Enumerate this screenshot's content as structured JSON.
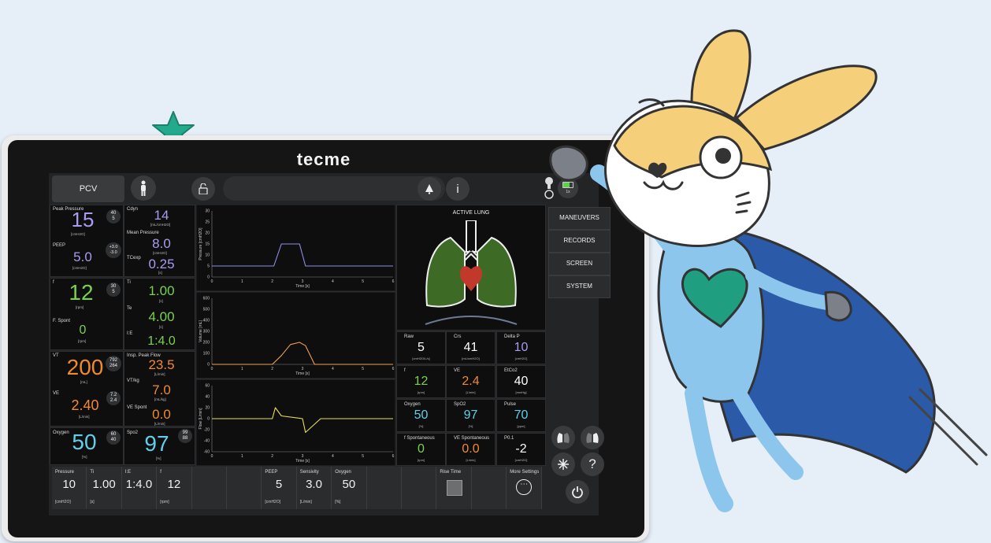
{
  "brand": "tecme",
  "top_bar": {
    "mode": "PCV",
    "info_icon_label": "i",
    "battery_label": "1x"
  },
  "left_panels": {
    "peak_pressure": {
      "label": "Peak Pressure",
      "value": "15",
      "unit": "[cmH2O]",
      "limit_high": "40",
      "limit_low": "5"
    },
    "peep": {
      "label": "PEEP",
      "value": "5.0",
      "unit": "[cmH2O]",
      "limit_high": "+3.0",
      "limit_low": "-3.0"
    },
    "cdyn": {
      "label": "Cdyn",
      "value": "14",
      "unit": "[mL/cmH2O]"
    },
    "mean_pressure": {
      "label": "Mean Pressure",
      "value": "8.0",
      "unit": "[cmH2O]"
    },
    "tcexp": {
      "label": "TCexp",
      "value": "0.25",
      "unit": "[s]"
    },
    "f": {
      "label": "f",
      "value": "12",
      "unit": "[rpm]",
      "limit_high": "30",
      "limit_low": "5"
    },
    "f_spont": {
      "label": "F. Spont",
      "value": "0",
      "unit": "[rpm]"
    },
    "ti": {
      "label": "Ti",
      "value": "1.00",
      "unit": "[s]"
    },
    "te": {
      "label": "Te",
      "value": "4.00",
      "unit": "[s]"
    },
    "ie": {
      "label": "I:E",
      "value": "1:4.0"
    },
    "vt": {
      "label": "VT",
      "value": "200",
      "unit": "[mL]",
      "limit_high": "792",
      "limit_low": "264"
    },
    "ve": {
      "label": "VE",
      "value": "2.40",
      "unit": "[L/min]",
      "limit_high": "7.2",
      "limit_low": "2.4"
    },
    "insp_peak_flow": {
      "label": "Insp. Peak Flow",
      "value": "23.5",
      "unit": "[L/min]"
    },
    "vt_kg": {
      "label": "VT/kg",
      "value": "7.0",
      "unit": "[mL/kg]"
    },
    "ve_spont": {
      "label": "VE Spont",
      "value": "0.0",
      "unit": "[L/min]"
    },
    "oxygen": {
      "label": "Oxygen",
      "value": "50",
      "unit": "[%]",
      "limit_high": "60",
      "limit_low": "40"
    },
    "spo2": {
      "label": "Spo2",
      "value": "97",
      "unit": "[%]",
      "limit_high": "99",
      "limit_low": "88"
    }
  },
  "lung": {
    "title": "ACTIVE LUNG"
  },
  "right_metrics": [
    {
      "label": "Raw",
      "value": "5",
      "unit": "[cmH2O/L/s]",
      "color": "#ffffff"
    },
    {
      "label": "Crs",
      "value": "41",
      "unit": "[mL/cmH2O]",
      "color": "#ffffff"
    },
    {
      "label": "Delta P",
      "value": "10",
      "unit": "[cmH2O]",
      "color": "#a99bf0"
    },
    {
      "label": "f",
      "value": "12",
      "unit": "[rpm]",
      "color": "#7ad24a"
    },
    {
      "label": "VE",
      "value": "2.4",
      "unit": "[L/min]",
      "color": "#f08a2c"
    },
    {
      "label": "EtCo2",
      "value": "40",
      "unit": "[mmHg]",
      "color": "#ffffff"
    },
    {
      "label": "Oxygen",
      "value": "50",
      "unit": "[%]",
      "color": "#5fd0e8"
    },
    {
      "label": "SpO2",
      "value": "97",
      "unit": "[%]",
      "color": "#5fd0e8"
    },
    {
      "label": "Pulse",
      "value": "70",
      "unit": "[ppm]",
      "color": "#5fd0e8"
    },
    {
      "label": "f Spontaneous",
      "value": "0",
      "unit": "[rpm]",
      "color": "#7ad24a"
    },
    {
      "label": "VE Spontaneous",
      "value": "0.0",
      "unit": "[L/min]",
      "color": "#f08a2c"
    },
    {
      "label": "P0.1",
      "value": "-2",
      "unit": "[cmH2O]",
      "color": "#ffffff"
    }
  ],
  "menu": [
    "MANEUVERS",
    "RECORDS",
    "SCREEN",
    "SYSTEM"
  ],
  "side_buttons": {
    "help_label": "?"
  },
  "settings": [
    {
      "label": "Pressure",
      "value": "10",
      "unit": "[cmH2O]"
    },
    {
      "label": "Ti",
      "value": "1.00",
      "unit": "[s]"
    },
    {
      "label": "I:E",
      "value": "1:4.0",
      "unit": ""
    },
    {
      "label": "f",
      "value": "12",
      "unit": "[rpm]"
    },
    {
      "label": "",
      "value": "",
      "unit": ""
    },
    {
      "label": "",
      "value": "",
      "unit": ""
    },
    {
      "label": "PEEP",
      "value": "5",
      "unit": "[cmH2O]"
    },
    {
      "label": "Sensivity",
      "value": "3.0",
      "unit": "[L/min]"
    },
    {
      "label": "Oxygen",
      "value": "50",
      "unit": "[%]"
    },
    {
      "label": "",
      "value": "",
      "unit": ""
    },
    {
      "label": "",
      "value": "",
      "unit": ""
    },
    {
      "label": "Rise Time",
      "value": "",
      "unit": ""
    },
    {
      "label": "",
      "value": "",
      "unit": ""
    },
    {
      "label": "More Settings",
      "value": "",
      "unit": ""
    }
  ],
  "chart_data": [
    {
      "type": "line",
      "ylabel": "Pressure [cmH2O]",
      "xlabel": "Time [s]",
      "xlim": [
        0,
        6
      ],
      "ylim": [
        0,
        30
      ],
      "xticks": [
        "0",
        "1",
        "2",
        "3",
        "4",
        "5",
        "6"
      ],
      "yticks": [
        "0",
        "5",
        "10",
        "15",
        "20",
        "25",
        "30"
      ],
      "color": "#8f8ee8",
      "x": [
        0,
        2.05,
        2.3,
        2.9,
        3.1,
        6
      ],
      "y": [
        5,
        5,
        15,
        15,
        5,
        5
      ]
    },
    {
      "type": "line",
      "ylabel": "Volume [mL]",
      "xlabel": "Time [s]",
      "xlim": [
        0,
        6
      ],
      "ylim": [
        0,
        600
      ],
      "xticks": [
        "0",
        "1",
        "2",
        "3",
        "4",
        "5",
        "6"
      ],
      "yticks": [
        "0",
        "100",
        "200",
        "300",
        "400",
        "500",
        "600"
      ],
      "color": "#f0a050",
      "x": [
        0,
        2.0,
        2.3,
        2.6,
        2.9,
        3.1,
        3.4,
        6
      ],
      "y": [
        0,
        0,
        80,
        180,
        200,
        170,
        0,
        0
      ]
    },
    {
      "type": "line",
      "ylabel": "Flow [L/min]",
      "xlabel": "Time [s]",
      "xlim": [
        0,
        6
      ],
      "ylim": [
        -60,
        60
      ],
      "xticks": [
        "0",
        "1",
        "2",
        "3",
        "4",
        "5",
        "6"
      ],
      "yticks": [
        "-60",
        "-40",
        "-20",
        "0",
        "20",
        "40",
        "60"
      ],
      "color": "#e8e050",
      "x": [
        0,
        2.0,
        2.1,
        2.3,
        3.0,
        3.1,
        3.3,
        3.6,
        6
      ],
      "y": [
        0,
        0,
        20,
        5,
        0,
        -25,
        -15,
        0,
        0
      ]
    }
  ]
}
